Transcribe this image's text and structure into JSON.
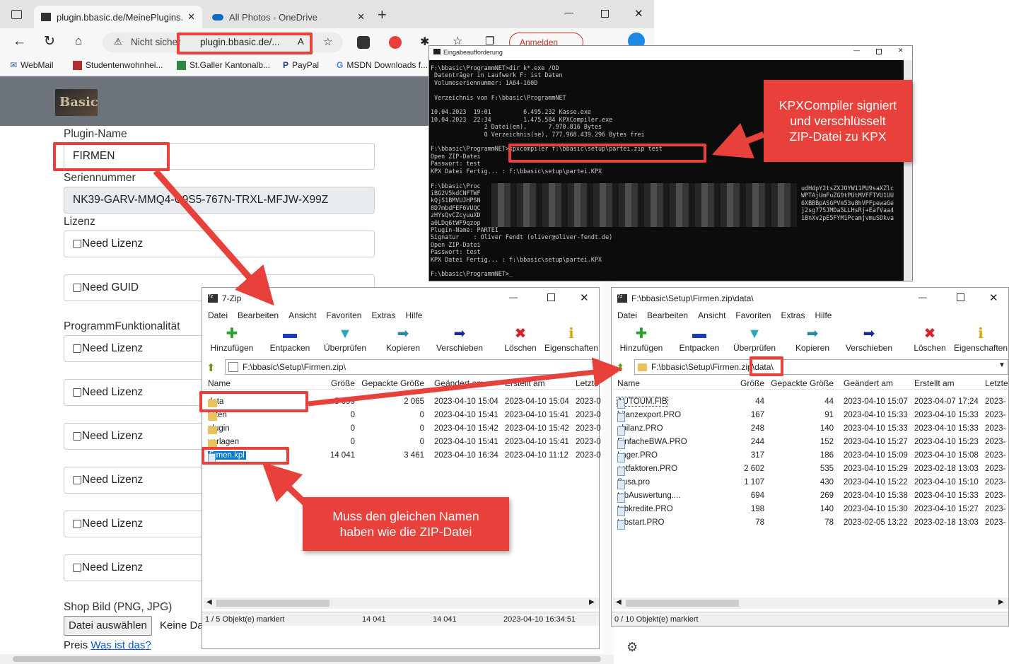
{
  "browser": {
    "tab1_title": "plugin.bbasic.de/MeinePlugins.a",
    "tab2_title": "All Photos - OneDrive",
    "insecure_label": "Nicht sicher",
    "address": "plugin.bbasic.de/...",
    "signin_label": "Anmelden",
    "favorites": [
      "WebMail",
      "Studentenwohnhei...",
      "St.Galler Kantonalb...",
      "PayPal",
      "MSDN Downloads f..."
    ]
  },
  "form": {
    "logo_text": "Basic",
    "plugin_name_label": "Plugin-Name",
    "plugin_name_value": "FIRMEN",
    "serial_label": "Seriennummer",
    "serial_value": "NK39-GARV-MMQ4-C9S5-767N-TRXL-MFJW-X99Z",
    "license_label": "Lizenz",
    "need_license": "Need Lizenz",
    "need_guid": "Need GUID",
    "functionality_label": "ProgrammFunktionalität",
    "shop_image_label": "Shop Bild (PNG, JPG)",
    "choose_file_button": "Datei auswählen",
    "no_file": "Keine Datei ausgewählt",
    "price_label": "Preis",
    "price_link": "Was ist das?"
  },
  "cmd": {
    "title": "Eingabeaufforderung",
    "lines": [
      "F:\\bbasic\\ProgrammNET>dir k*.exe /OD",
      " Datenträger in Laufwerk F: ist Daten",
      " Volumeseriennummer: 1A64-160D",
      "",
      " Verzeichnis von F:\\bbasic\\ProgrammNET",
      "",
      "10.04.2023  19:01         6.495.232 Kasse.exe",
      "10.04.2023  22:34         1.475.584 KPXCompiler.exe",
      "               2 Datei(en),      7.970.816 Bytes",
      "               0 Verzeichnis(se), 777.968.439.296 Bytes frei",
      "",
      "F:\\bbasic\\ProgrammNET>kpxcompiler f:\\bbasic\\setup\\partei.zip test",
      "Open ZIP-Datei",
      "Passwort: test",
      "KPX Datei Fertig... : f:\\bbasic\\setup\\partei.KPX",
      "",
      "F:\\bbasic\\Proc",
      "iBG2V5kdCNFTWF",
      "kQjS1BMVUJHPSN",
      "8D7mbdFEF6VUQC",
      "zHYsQvCZcyuuXD",
      "a0LDq6tWF9qzop",
      "Plugin-Name: PARTEI",
      "Signatur    : Oliver Fendt (oliver@oliver-fendt.de)",
      "Open ZIP-Datei",
      "Passwort: test",
      "KPX Datei Fertig... : f:\\bbasic\\setup\\partei.KPX",
      "",
      "F:\\bbasic\\ProgrammNET>_"
    ],
    "right_lines": [
      "udHdpY2tsZXJOYW11PU9saXZlc",
      "WPTAjUmFuZG9tPUtMVFFTVU1UU",
      "6XBBBpASGPVm53u8hVPFpewaGe",
      "j2sg77SJMDa5LLHsRj+EafVaa4",
      "1BnXv2pE5FYM1PcamjvmuSDkva"
    ]
  },
  "callouts": {
    "kpx": "KPXCompiler signiert und verschlüsselt ZIP-Datei zu KPX",
    "name": "Muss den gleichen Namen haben wie die ZIP-Datei"
  },
  "zip_left": {
    "title": "7-Zip",
    "menu": [
      "Datei",
      "Bearbeiten",
      "Ansicht",
      "Favoriten",
      "Extras",
      "Hilfe"
    ],
    "toolbar": [
      "Hinzufügen",
      "Entpacken",
      "Überprüfen",
      "Kopieren",
      "Verschieben",
      "Löschen",
      "Eigenschaften"
    ],
    "path": "F:\\bbasic\\Setup\\Firmen.zip\\",
    "columns": [
      "Name",
      "Größe",
      "Gepackte Größe",
      "Geändert am",
      "Erstellt am",
      "Letzte"
    ],
    "rows": [
      {
        "name": "data",
        "size": "5 099",
        "packed": "2 065",
        "modified": "2023-04-10 15:04",
        "created": "2023-04-10 15:04",
        "last": "2023-0",
        "type": "folder"
      },
      {
        "name": "listen",
        "size": "0",
        "packed": "0",
        "modified": "2023-04-10 15:41",
        "created": "2023-04-10 15:41",
        "last": "2023-0",
        "type": "folder"
      },
      {
        "name": "plugin",
        "size": "0",
        "packed": "0",
        "modified": "2023-04-10 15:42",
        "created": "2023-04-10 15:42",
        "last": "2023-0",
        "type": "folder"
      },
      {
        "name": "vorlagen",
        "size": "0",
        "packed": "0",
        "modified": "2023-04-10 15:41",
        "created": "2023-04-10 15:41",
        "last": "2023-0",
        "type": "folder"
      },
      {
        "name": "firmen.kpl",
        "size": "14 041",
        "packed": "3 461",
        "modified": "2023-04-10 16:34",
        "created": "2023-04-10 11:12",
        "last": "2023-0",
        "type": "file"
      }
    ],
    "status_selected": "1 / 5 Objekt(e) markiert",
    "status_size": "14 041",
    "status_packed": "14 041",
    "status_date": "2023-04-10 16:34:51"
  },
  "zip_right": {
    "title": "F:\\bbasic\\Setup\\Firmen.zip\\data\\",
    "menu": [
      "Datei",
      "Bearbeiten",
      "Ansicht",
      "Favoriten",
      "Extras",
      "Hilfe"
    ],
    "toolbar": [
      "Hinzufügen",
      "Entpacken",
      "Überprüfen",
      "Kopieren",
      "Verschieben",
      "Löschen",
      "Eigenschaften"
    ],
    "path_prefix": "F:\\bbasic\\Setup\\Firmen.zip",
    "path_suffix": "\\data\\",
    "columns": [
      "Name",
      "Größe",
      "Gepackte Größe",
      "Geändert am",
      "Erstellt am",
      "Letzte"
    ],
    "rows": [
      {
        "name": "AUTOUM.FIB",
        "size": "44",
        "packed": "44",
        "modified": "2023-04-10 15:07",
        "created": "2023-04-07 17:24",
        "last": "2023-"
      },
      {
        "name": "bilanzexport.PRO",
        "size": "167",
        "packed": "91",
        "modified": "2023-04-10 15:33",
        "created": "2023-04-10 15:33",
        "last": "2023-"
      },
      {
        "name": "ebilanz.PRO",
        "size": "248",
        "packed": "140",
        "modified": "2023-04-10 15:33",
        "created": "2023-04-10 15:33",
        "last": "2023-"
      },
      {
        "name": "EinfacheBWA.PRO",
        "size": "244",
        "packed": "152",
        "modified": "2023-04-10 15:27",
        "created": "2023-04-10 15:23",
        "last": "2023-"
      },
      {
        "name": "Lager.PRO",
        "size": "317",
        "packed": "186",
        "modified": "2023-04-10 15:09",
        "created": "2023-04-10 15:08",
        "last": "2023-"
      },
      {
        "name": "setfaktoren.PRO",
        "size": "2 602",
        "packed": "535",
        "modified": "2023-04-10 15:29",
        "created": "2023-02-18 13:03",
        "last": "2023-"
      },
      {
        "name": "Susa.pro",
        "size": "1 107",
        "packed": "430",
        "modified": "2023-04-10 15:22",
        "created": "2023-04-10 15:10",
        "last": "2023-"
      },
      {
        "name": "tabAuswertung....",
        "size": "694",
        "packed": "269",
        "modified": "2023-04-10 15:38",
        "created": "2023-04-10 15:33",
        "last": "2023-"
      },
      {
        "name": "tabkredite.PRO",
        "size": "198",
        "packed": "140",
        "modified": "2023-04-10 15:30",
        "created": "2023-04-10 15:27",
        "last": "2023-"
      },
      {
        "name": "tabstart.PRO",
        "size": "78",
        "packed": "78",
        "modified": "2023-02-05 13:22",
        "created": "2023-02-18 13:03",
        "last": "2023-"
      }
    ],
    "status_selected": "0 / 10 Objekt(e) markiert"
  }
}
